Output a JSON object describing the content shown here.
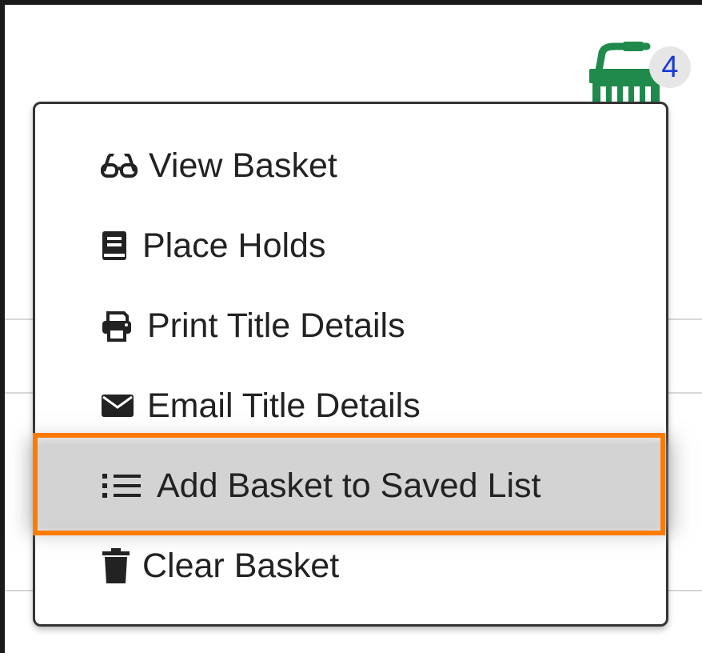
{
  "basket": {
    "count": "4",
    "icon": "basket-icon",
    "color": "#1f8a4c"
  },
  "menu": {
    "items": [
      {
        "label": "View Basket",
        "icon": "glasses-icon"
      },
      {
        "label": "Place Holds",
        "icon": "book-icon"
      },
      {
        "label": "Print Title Details",
        "icon": "print-icon"
      },
      {
        "label": "Email Title Details",
        "icon": "envelope-icon"
      },
      {
        "label": "Add Basket to Saved List",
        "icon": "list-icon",
        "highlighted": true
      },
      {
        "label": "Clear Basket",
        "icon": "trash-icon"
      }
    ]
  },
  "colors": {
    "highlight_border": "#ff7b00",
    "highlight_bg": "#d3d3d3",
    "badge_text": "#1a3bd6"
  }
}
